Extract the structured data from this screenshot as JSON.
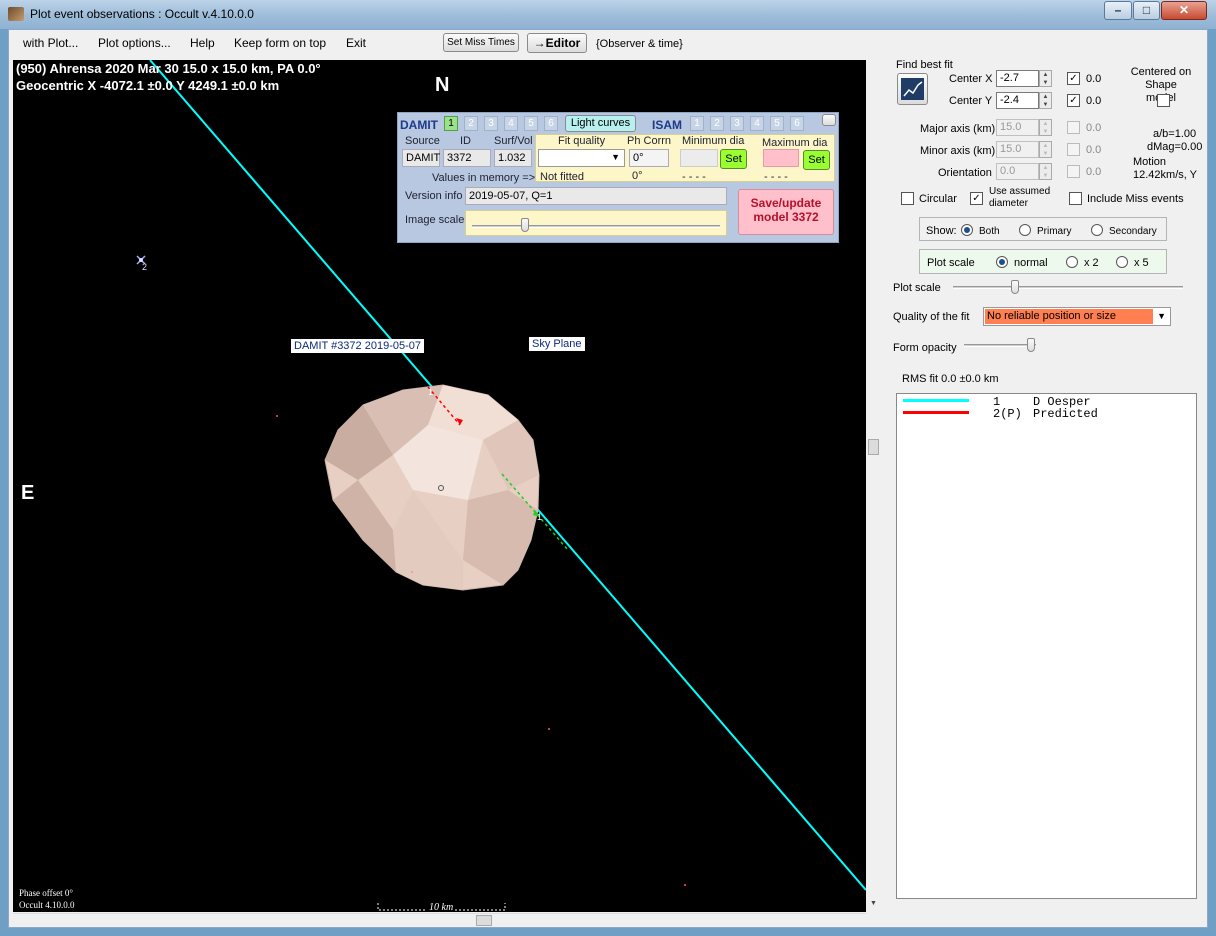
{
  "window": {
    "title": "Plot event observations : Occult v.4.10.0.0",
    "min": "–",
    "max": "□",
    "close": "✕"
  },
  "menu": {
    "items": [
      "with Plot...",
      "Plot options...",
      "Help",
      "Keep form on top",
      "Exit"
    ],
    "set_miss_times": "Set Miss Times",
    "editor": "→Editor",
    "observer_time": "{Observer & time}"
  },
  "plot": {
    "header_line1": "(950) Ahrensa  2020 Mar 30  15.0 x 15.0 km, PA 0.0°",
    "header_line2": "Geocentric X  -4072.1 ±0.0  Y 4249.1 ±0.0 km",
    "north": "N",
    "east": "E",
    "model_label": "DAMIT #3372 2019-05-07",
    "sky_plane": "Sky Plane",
    "chord1_label": "1",
    "chord1_label2": "1",
    "star2_label": "2",
    "phase_offset": "Phase offset 0°",
    "occult_version": "Occult 4.10.0.0",
    "scale_bar": "10 km"
  },
  "damit": {
    "damit_label": "DAMIT",
    "isam_label": "ISAM",
    "damit_nums": [
      "1",
      "2",
      "3",
      "4",
      "5",
      "6"
    ],
    "isam_nums": [
      "1",
      "2",
      "3",
      "4",
      "5",
      "6"
    ],
    "light_curves": "Light curves",
    "source_h": "Source",
    "id_h": "ID",
    "surfvol_h": "Surf/Vol",
    "source": "DAMIT",
    "id": "3372",
    "surfvol": "1.032",
    "fit_quality_h": "Fit quality",
    "ph_corrn_h": "Ph Corrn",
    "min_dia_h": "Minimum dia",
    "max_dia_h": "Maximum dia",
    "ph_corrn_val": "0°",
    "set": "Set",
    "values_in_memory": "Values in memory =>",
    "not_fitted": "Not fitted",
    "mem_ph": "0°",
    "dashes": "- - - -",
    "version_info_lbl": "Version info",
    "version_info": "2019-05-07, Q=1",
    "image_scale_lbl": "Image scale",
    "save_update": "Save/update model 3372"
  },
  "right": {
    "find_best_fit": "Find best fit",
    "center_x_lbl": "Center X",
    "center_x": "-2.7",
    "center_x_fix": "0.0",
    "center_y_lbl": "Center Y",
    "center_y": "-2.4",
    "center_y_fix": "0.0",
    "centered_on_shape": "Centered on Shape model",
    "major_lbl": "Major axis (km)",
    "major": "15.0",
    "major_fix": "0.0",
    "minor_lbl": "Minor axis (km)",
    "minor": "15.0",
    "minor_fix": "0.0",
    "orient_lbl": "Orientation",
    "orient": "0.0",
    "orient_fix": "0.0",
    "ab": "a/b=1.00",
    "dmag": "dMag=0.00",
    "motion": "Motion",
    "motion_val": "12.42km/s, Y",
    "circular": "Circular",
    "use_assumed": "Use assumed diameter",
    "include_miss": "Include Miss events",
    "show_lbl": "Show:",
    "show_opts": [
      "Both",
      "Primary",
      "Secondary"
    ],
    "plot_scale_lbl": "Plot scale",
    "scale_opts": [
      "normal",
      "x 2",
      "x 5"
    ],
    "plot_scale_slider": "Plot scale",
    "quality_lbl": "Quality of the fit",
    "quality_val": "No reliable position or size",
    "form_opacity": "Form opacity",
    "rms": "RMS fit 0.0 ±0.0 km",
    "legend": [
      {
        "num": "1",
        "name": "D Oesper",
        "color": "#00ffff"
      },
      {
        "num": "2(P)",
        "name": "Predicted",
        "color": "#ff0000"
      }
    ]
  },
  "colors": {
    "chord": "#00ffff",
    "asteroid": "#e9d3c8",
    "fit_quality_bg": "#ff7f50",
    "save_bg": "#ffc0cb",
    "set_bg": "#99ff33"
  }
}
